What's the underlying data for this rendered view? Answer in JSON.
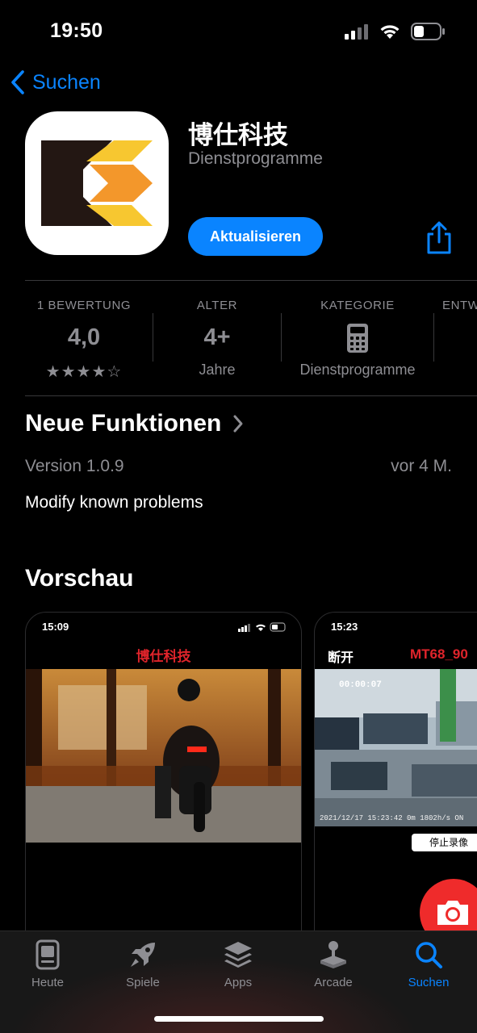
{
  "status_bar": {
    "time": "19:50"
  },
  "nav": {
    "back_label": "Suchen"
  },
  "app": {
    "name": "博仕科技",
    "category": "Dienstprogramme",
    "update_label": "Aktualisieren"
  },
  "info": {
    "ratings": {
      "header": "1 BEWERTUNG",
      "value": "4,0",
      "stars": "★★★★☆",
      "rating": 4
    },
    "age": {
      "header": "ALTER",
      "value": "4+",
      "sub": "Jahre"
    },
    "category": {
      "header": "KATEGORIE",
      "icon": "calculator-icon",
      "sub": "Dienstprogramme"
    },
    "developer": {
      "header": "ENTW"
    }
  },
  "whats_new": {
    "title": "Neue Funktionen",
    "version": "Version 1.0.9",
    "date": "vor 4 M.",
    "notes": "Modify known problems"
  },
  "preview": {
    "title": "Vorschau",
    "shots": [
      {
        "time": "15:09",
        "title": "博仕科技"
      },
      {
        "time": "15:23",
        "left_label": "断开",
        "device": "MT68_90",
        "rec_time": "00:00:07",
        "stamp": "2021/12/17 15:23:42  0m 1802h/s  ON",
        "stop_label": "停止录像"
      }
    ]
  },
  "tabs": [
    {
      "label": "Heute",
      "icon": "today-icon"
    },
    {
      "label": "Spiele",
      "icon": "rocket-icon"
    },
    {
      "label": "Apps",
      "icon": "layers-icon"
    },
    {
      "label": "Arcade",
      "icon": "joystick-icon"
    },
    {
      "label": "Suchen",
      "icon": "search-icon",
      "active": true
    }
  ],
  "colors": {
    "accent": "#0a84ff",
    "secondary_text": "#8e8e93",
    "red": "#e0242b"
  }
}
